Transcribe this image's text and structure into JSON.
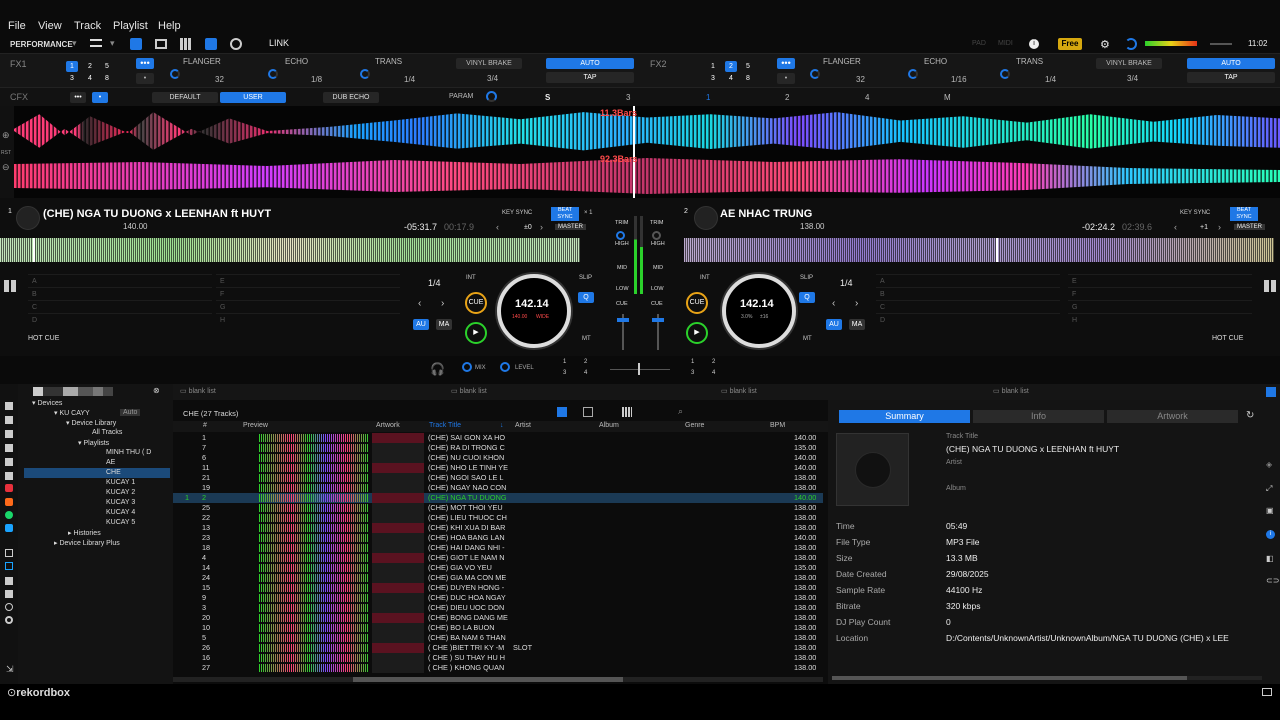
{
  "menu": [
    "File",
    "View",
    "Track",
    "Playlist",
    "Help"
  ],
  "toolbar": {
    "mode": "PERFORMANCE",
    "link": "LINK",
    "pad": "PAD",
    "midi": "MIDI",
    "plan": "Free",
    "clock": "11:02"
  },
  "fx1": {
    "label": "FX1",
    "nums": [
      "1",
      "2",
      "5",
      "3",
      "4",
      "8"
    ],
    "effects": [
      "FLANGER",
      "ECHO",
      "TRANS",
      "VINYL BRAKE"
    ],
    "values": [
      "32",
      "1/8",
      "1/4",
      "3/4"
    ],
    "auto": "AUTO",
    "tap": "TAP"
  },
  "fx2": {
    "label": "FX2",
    "nums": [
      "1",
      "2",
      "5",
      "3",
      "4",
      "8"
    ],
    "effects": [
      "FLANGER",
      "ECHO",
      "TRANS",
      "VINYL BRAKE"
    ],
    "values": [
      "32",
      "1/16",
      "1/4",
      "3/4"
    ],
    "auto": "AUTO",
    "tap": "TAP"
  },
  "cfx": {
    "label": "CFX",
    "default": "DEFAULT",
    "user": "USER",
    "dub": "DUB ECHO",
    "param": "PARAM",
    "s": "S",
    "nums": [
      "3",
      "1",
      "2",
      "4",
      "M"
    ]
  },
  "wave": {
    "bars1": "11.3Bars",
    "bars2": "92.3Bars"
  },
  "deck1": {
    "num": "1",
    "title": "(CHE) NGA TU DUONG x LEENHAN ft HUYT",
    "bpm": "140.00",
    "remain": "-05:31.7",
    "elapsed": "00:17.9",
    "keysync": "KEY SYNC",
    "keyval": "±0",
    "beatsync": "BEAT SYNC",
    "x1": "× 1",
    "master": "MASTER",
    "loop": "1/4",
    "int": "INT",
    "cue": "CUE",
    "slip": "SLIP",
    "q": "Q",
    "au": "AU",
    "ma": "MA",
    "mt": "MT",
    "jog_bpm": "142.14",
    "jog_a": "140.00",
    "jog_b": "WIDE",
    "hotcue": "HOT CUE",
    "pads": [
      "A",
      "B",
      "C",
      "D",
      "E",
      "F",
      "G",
      "H"
    ]
  },
  "deck2": {
    "num": "2",
    "title": "AE NHAC TRUNG",
    "bpm": "138.00",
    "remain": "-02:24.2",
    "elapsed": "02:39.6",
    "keysync": "KEY SYNC",
    "keyval": "+1",
    "beatsync": "BEAT SYNC",
    "master": "MASTER",
    "loop": "1/4",
    "int": "INT",
    "cue": "CUE",
    "slip": "SLIP",
    "q": "Q",
    "au": "AU",
    "ma": "MA",
    "mt": "MT",
    "jog_bpm": "142.14",
    "jog_a": "3.0%",
    "jog_b": "±16",
    "hotcue": "HOT CUE",
    "pads": [
      "A",
      "B",
      "C",
      "D",
      "E",
      "F",
      "G",
      "H"
    ]
  },
  "mixer": {
    "trim": "TRIM",
    "high": "HIGH",
    "mid": "MID",
    "low": "LOW",
    "cue": "CUE",
    "mix": "MIX",
    "level": "LEVEL",
    "n": [
      "1",
      "2",
      "3",
      "4"
    ]
  },
  "tree": {
    "devices": "Devices",
    "dev": "KU CAYY",
    "auto": "Auto",
    "devlib": "Device Library",
    "all": "All Tracks",
    "playlists": "Playlists",
    "items": [
      "MINH THU ( D",
      "AE",
      "CHE",
      "KUCAY 1",
      "KUCAY 2",
      "KUCAY 3",
      "KUCAY 4",
      "KUCAY 5"
    ],
    "histories": "Histories",
    "plus": "Device Library Plus"
  },
  "tabs": [
    "blank list",
    "blank list",
    "blank list",
    "blank list"
  ],
  "list": {
    "name": "CHE (27 Tracks)",
    "cols": [
      "#",
      "Preview",
      "Artwork",
      "Track Title",
      "Artist",
      "Album",
      "Genre",
      "BPM"
    ],
    "rows": [
      [
        "1",
        "(CHE) SAI GON XA HO",
        "",
        "140.00"
      ],
      [
        "7",
        "(CHE) RA DI TRONG C",
        "",
        "135.00"
      ],
      [
        "6",
        "(CHE) NU CUOI KHON",
        "",
        "140.00"
      ],
      [
        "11",
        "(CHE) NHO LE TINH YE",
        "",
        "140.00"
      ],
      [
        "21",
        "(CHE) NGOI SAO LE L",
        "",
        "138.00"
      ],
      [
        "19",
        "(CHE) NGAY NAO CON",
        "",
        "138.00"
      ],
      [
        "2",
        "(CHE) NGA TU DUONG",
        "",
        "140.00"
      ],
      [
        "25",
        "(CHE) MOT THOI YEU",
        "",
        "138.00"
      ],
      [
        "22",
        "(CHE) LIEU THUOC CH",
        "",
        "138.00"
      ],
      [
        "13",
        "(CHE) KHI XUA DI BAR",
        "",
        "138.00"
      ],
      [
        "23",
        "(CHE) HOA BANG LAN",
        "",
        "140.00"
      ],
      [
        "18",
        "(CHE) HAI DANG NHI -",
        "",
        "138.00"
      ],
      [
        "4",
        "(CHE) GIOT LE NAM N",
        "",
        "138.00"
      ],
      [
        "14",
        "(CHE) GIA VO YEU",
        "",
        "135.00"
      ],
      [
        "24",
        "(CHE) GIA MA CON ME",
        "",
        "138.00"
      ],
      [
        "15",
        "(CHE) DUYEN HONG -",
        "",
        "138.00"
      ],
      [
        "9",
        "(CHE) DUC HOA NGAY",
        "",
        "138.00"
      ],
      [
        "3",
        "(CHE) DIEU UOC DON",
        "",
        "138.00"
      ],
      [
        "20",
        "(CHE) BONG DANG ME",
        "",
        "138.00"
      ],
      [
        "10",
        "(CHE) BO LA BUON",
        "",
        "138.00"
      ],
      [
        "5",
        "(CHE) BA NAM 6 THAN",
        "",
        "138.00"
      ],
      [
        "26",
        "( CHE )BIET TRI KY -M",
        "SLOT",
        "138.00"
      ],
      [
        "16",
        "( CHE ) SU THAY HU H",
        "",
        "138.00"
      ],
      [
        "27",
        "( CHE ) KHONG QUAN",
        "",
        "138.00"
      ]
    ],
    "playing_mark": "1"
  },
  "info": {
    "tabs": [
      "Summary",
      "Info",
      "Artwork"
    ],
    "track_title_label": "Track Title",
    "track_title": "(CHE) NGA TU DUONG x LEENHAN ft HUYT",
    "artist_label": "Artist",
    "album_label": "Album",
    "fields": [
      [
        "Time",
        "05:49"
      ],
      [
        "File Type",
        "MP3 File"
      ],
      [
        "Size",
        "13.3 MB"
      ],
      [
        "Date Created",
        "29/08/2025"
      ],
      [
        "Sample Rate",
        "44100 Hz"
      ],
      [
        "Bitrate",
        "320 kbps"
      ],
      [
        "DJ Play Count",
        "0"
      ],
      [
        "Location",
        "D:/Contents/UnknownArtist/UnknownAlbum/NGA TU DUONG (CHE) x LEE"
      ]
    ]
  },
  "brand": "rekordbox",
  "colors": {
    "accent": "#1f78e6",
    "playing": "#2bd12b",
    "cue": "#e8a317",
    "play": "#2bd12b"
  }
}
